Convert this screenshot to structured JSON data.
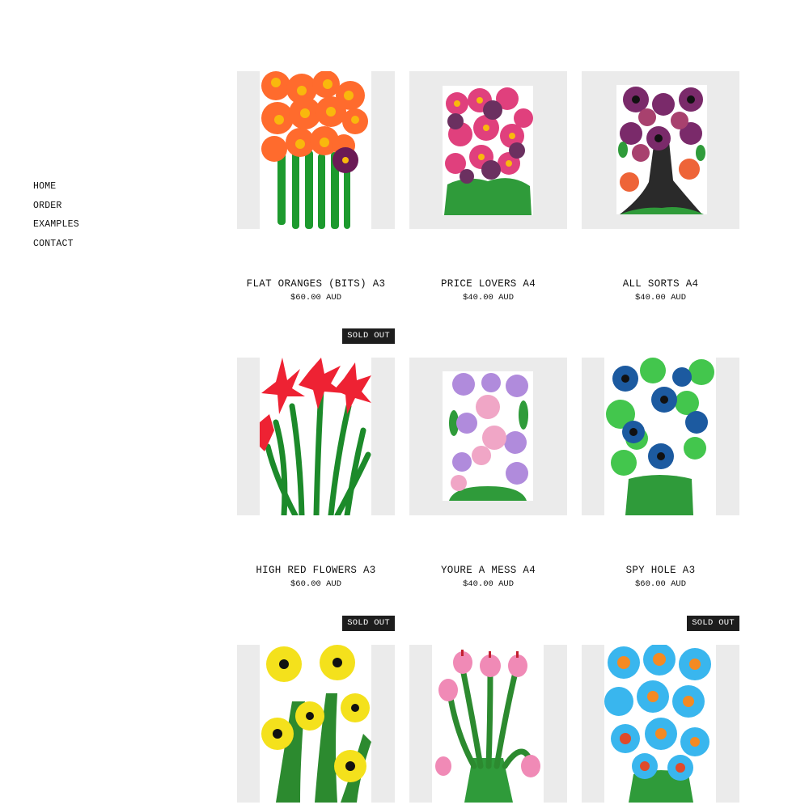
{
  "nav": {
    "items": [
      {
        "label": "HOME"
      },
      {
        "label": "ORDER"
      },
      {
        "label": "EXAMPLES"
      },
      {
        "label": "CONTACT"
      }
    ]
  },
  "products": [
    {
      "title": "FLAT ORANGES (BITS) A3",
      "price": "$60.00 AUD",
      "badge": ""
    },
    {
      "title": "PRICE LOVERS A4",
      "price": "$40.00 AUD",
      "badge": ""
    },
    {
      "title": "ALL SORTS A4",
      "price": "$40.00 AUD",
      "badge": ""
    },
    {
      "title": "HIGH RED FLOWERS A3",
      "price": "$60.00 AUD",
      "badge": "SOLD OUT"
    },
    {
      "title": "YOURE A MESS A4",
      "price": "$40.00 AUD",
      "badge": ""
    },
    {
      "title": "SPY HOLE A3",
      "price": "$60.00 AUD",
      "badge": ""
    },
    {
      "title": "",
      "price": "",
      "badge": "SOLD OUT"
    },
    {
      "title": "",
      "price": "",
      "badge": ""
    },
    {
      "title": "",
      "price": "",
      "badge": "SOLD OUT"
    }
  ],
  "colors": {
    "frame_bg": "#ebebeb",
    "badge_bg": "#1d1d1d",
    "text": "#111111"
  }
}
